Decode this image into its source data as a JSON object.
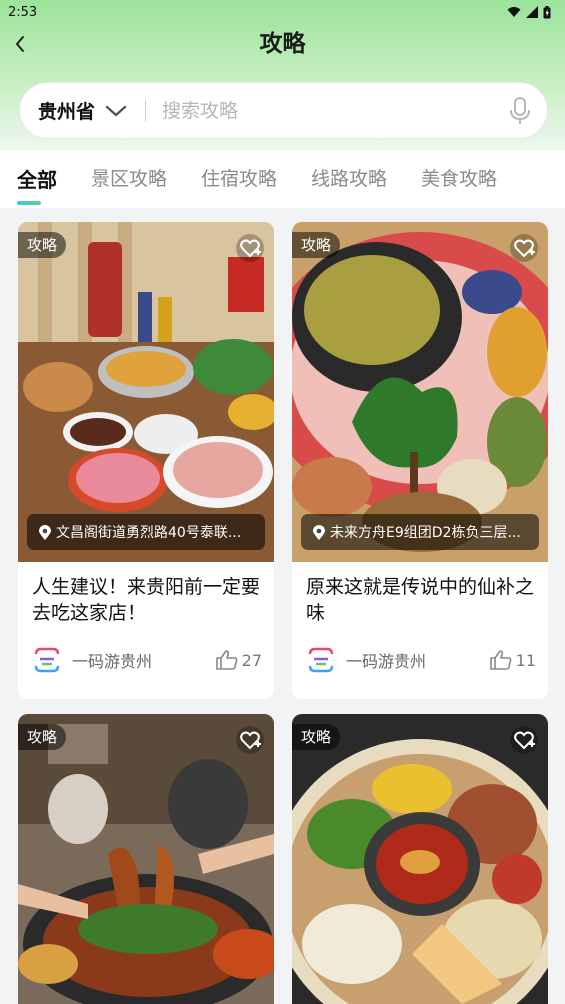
{
  "status_bar": {
    "time": "2:53"
  },
  "nav": {
    "title": "攻略"
  },
  "search": {
    "region": "贵州省",
    "placeholder": "搜索攻略"
  },
  "tabs": [
    {
      "label": "全部",
      "active": true
    },
    {
      "label": "景区攻略",
      "active": false
    },
    {
      "label": "住宿攻略",
      "active": false
    },
    {
      "label": "线路攻略",
      "active": false
    },
    {
      "label": "美食攻略",
      "active": false
    }
  ],
  "cards": [
    {
      "tag": "攻略",
      "location": "文昌阁街道勇烈路40号泰联...",
      "title": "人生建议！来贵阳前一定要去吃这家店！",
      "author": "一码游贵州",
      "likes": "27"
    },
    {
      "tag": "攻略",
      "location": "未来方舟E9组团D2栋负三层...",
      "title": "原来这就是传说中的仙补之味",
      "author": "一码游贵州",
      "likes": "11"
    },
    {
      "tag": "攻略"
    },
    {
      "tag": "攻略"
    }
  ],
  "colors": {
    "accent_gradient_start": "#3fc6e8",
    "accent_gradient_end": "#5fd28a",
    "header_green": "#9be39a"
  }
}
